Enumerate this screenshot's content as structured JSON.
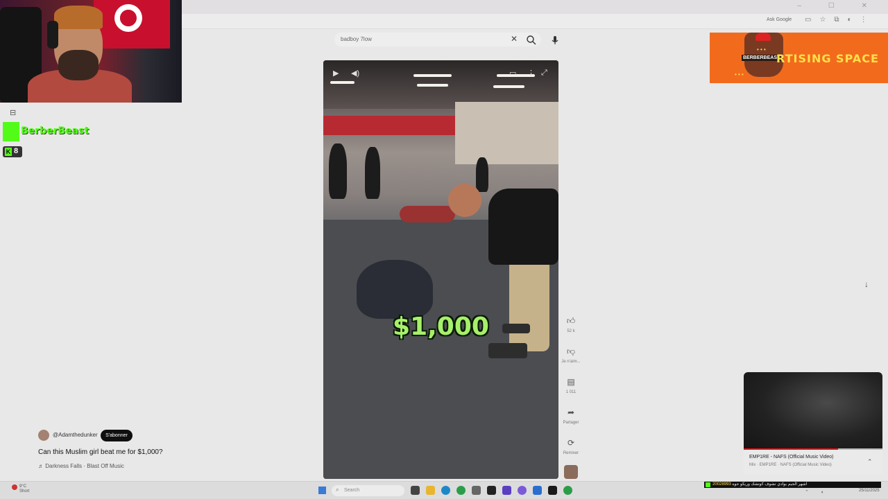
{
  "browser": {
    "ask_google": "Ask Google"
  },
  "search": {
    "query": "badboy 7low",
    "clear_icon": "close-icon",
    "search_icon": "search-icon",
    "mic_icon": "mic-icon"
  },
  "video": {
    "overlay_text": "$1,000"
  },
  "actions": {
    "like_count": "52 k",
    "dislike_label": "Je n'aim...",
    "comments_count": "1 011",
    "share_label": "Partager",
    "remix_label": "Remixer"
  },
  "info": {
    "channel": "@Adamthedunker",
    "subscribe": "S'abonner",
    "title": "Can this Muslim girl beat me for $1,000?",
    "music": "♬ Darkness Falls · Blast Off Music"
  },
  "mini_player": {
    "title": "EMP1RE - NAFS (Official Music Video)",
    "subtitle": "Mix · EMP1RE · NAFS (Official Music Video)",
    "progress": 0.68
  },
  "stream": {
    "kick_name": "BerberBeast",
    "viewers": "8",
    "ad_text": "RTISING SPACE",
    "ad_logo_text": "BERBERBEAST",
    "ad_dots": "• • •"
  },
  "taskbar": {
    "weather_temp": "9°C",
    "weather_desc": "Short",
    "search_label": "Search",
    "ticker_number": "20028993",
    "ticker_text": "اشهر الجيم بوادي تشوف كوتشك وريكو جوه",
    "date": "25/11/2025"
  },
  "colors": {
    "kick_green": "#53fc18",
    "ad_orange": "#f26b1d",
    "ad_yellow": "#ffe04a",
    "money_green": "#a6f06a"
  }
}
